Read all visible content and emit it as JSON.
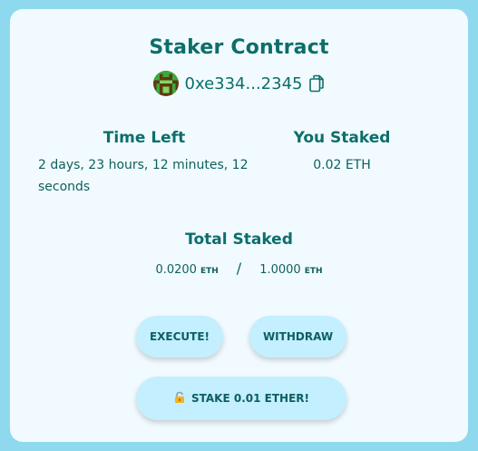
{
  "card": {
    "title": "Staker Contract",
    "address": "0xe334...2345"
  },
  "time_left": {
    "label": "Time Left",
    "value": "2 days, 23 hours, 12 minutes, 12 seconds"
  },
  "you_staked": {
    "label": "You Staked",
    "value": "0.02 ETH"
  },
  "total_staked": {
    "label": "Total Staked",
    "current": "0.0200",
    "current_unit": "ETH",
    "separator": "/",
    "threshold": "1.0000",
    "threshold_unit": "ETH"
  },
  "buttons": {
    "execute": "EXECUTE!",
    "withdraw": "WITHDRAW",
    "stake": "STAKE 0.01 ETHER!",
    "stake_icon": "padlock-icon"
  },
  "icons": {
    "copy": "copy-icon",
    "avatar": "blockie-avatar"
  },
  "colors": {
    "background": "#8fd9ee",
    "card": "#f1fbff",
    "accent_text": "#0c6e6b",
    "button": "#c3efff"
  }
}
